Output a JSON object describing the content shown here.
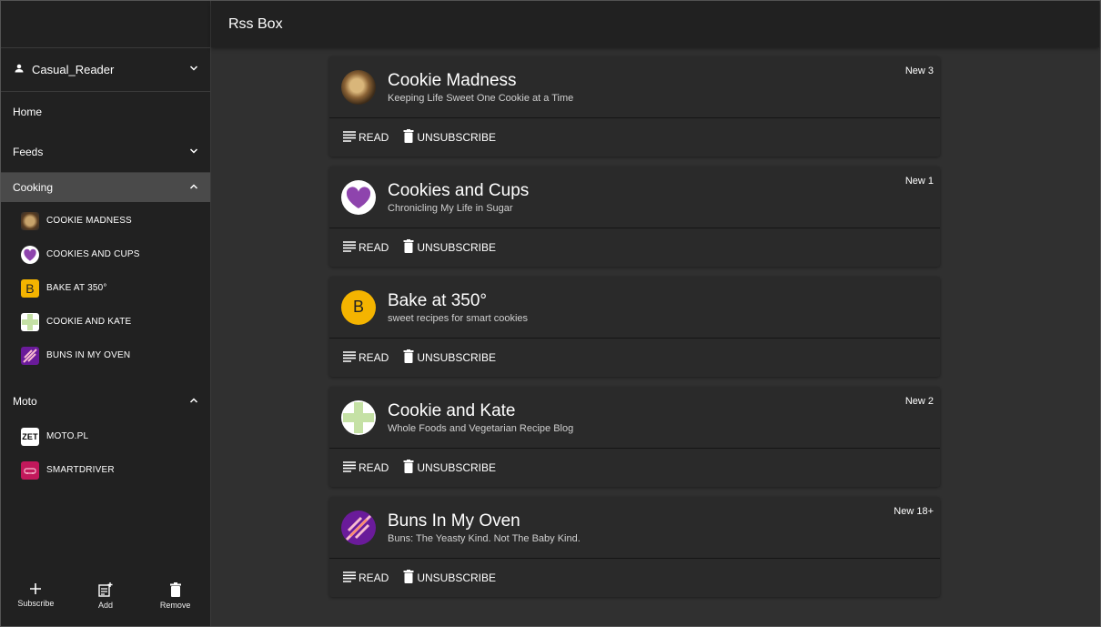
{
  "app": {
    "title": "Rss Box"
  },
  "user": {
    "name": "Casual_Reader"
  },
  "nav": {
    "home": "Home",
    "feeds": "Feeds"
  },
  "groups": [
    {
      "label": "Cooking",
      "active": true,
      "items": [
        {
          "label": "COOKIE MADNESS",
          "icon": "cookie-image"
        },
        {
          "label": "COOKIES AND CUPS",
          "icon": "heart-icon"
        },
        {
          "label": "BAKE AT 350°",
          "icon": "letter-b-icon"
        },
        {
          "label": "COOKIE AND KATE",
          "icon": "green-plus-icon"
        },
        {
          "label": "BUNS IN MY OVEN",
          "icon": "whisk-icon"
        }
      ]
    },
    {
      "label": "Moto",
      "active": false,
      "items": [
        {
          "label": "MOTO.PL",
          "icon": "zet-logo"
        },
        {
          "label": "SMARTDRIVER",
          "icon": "car-icon"
        }
      ]
    }
  ],
  "sidebar_actions": {
    "subscribe": "Subscribe",
    "add": "Add",
    "remove": "Remove"
  },
  "cards": [
    {
      "title": "Cookie Madness",
      "subtitle": "Keeping Life Sweet One Cookie at a Time",
      "badge": "New 3",
      "read": "READ",
      "unsubscribe": "UNSUBSCRIBE"
    },
    {
      "title": "Cookies and Cups",
      "subtitle": "Chronicling My Life in Sugar",
      "badge": "New 1",
      "read": "READ",
      "unsubscribe": "UNSUBSCRIBE"
    },
    {
      "title": "Bake at 350°",
      "subtitle": "sweet recipes for smart cookies",
      "badge": "",
      "avatar_letter": "B",
      "read": "READ",
      "unsubscribe": "UNSUBSCRIBE"
    },
    {
      "title": "Cookie and Kate",
      "subtitle": "Whole Foods and Vegetarian Recipe Blog",
      "badge": "New 2",
      "read": "READ",
      "unsubscribe": "UNSUBSCRIBE"
    },
    {
      "title": "Buns In My Oven",
      "subtitle": "Buns: The Yeasty Kind. Not The Baby Kind.",
      "badge": "New 18+",
      "read": "READ",
      "unsubscribe": "UNSUBSCRIBE"
    }
  ],
  "colors": {
    "purple": "#8e44ad",
    "yellow": "#f4b400",
    "light_green": "#c5e1a5",
    "pink": "#c2185b",
    "dark_purple": "#6a1b9a"
  }
}
